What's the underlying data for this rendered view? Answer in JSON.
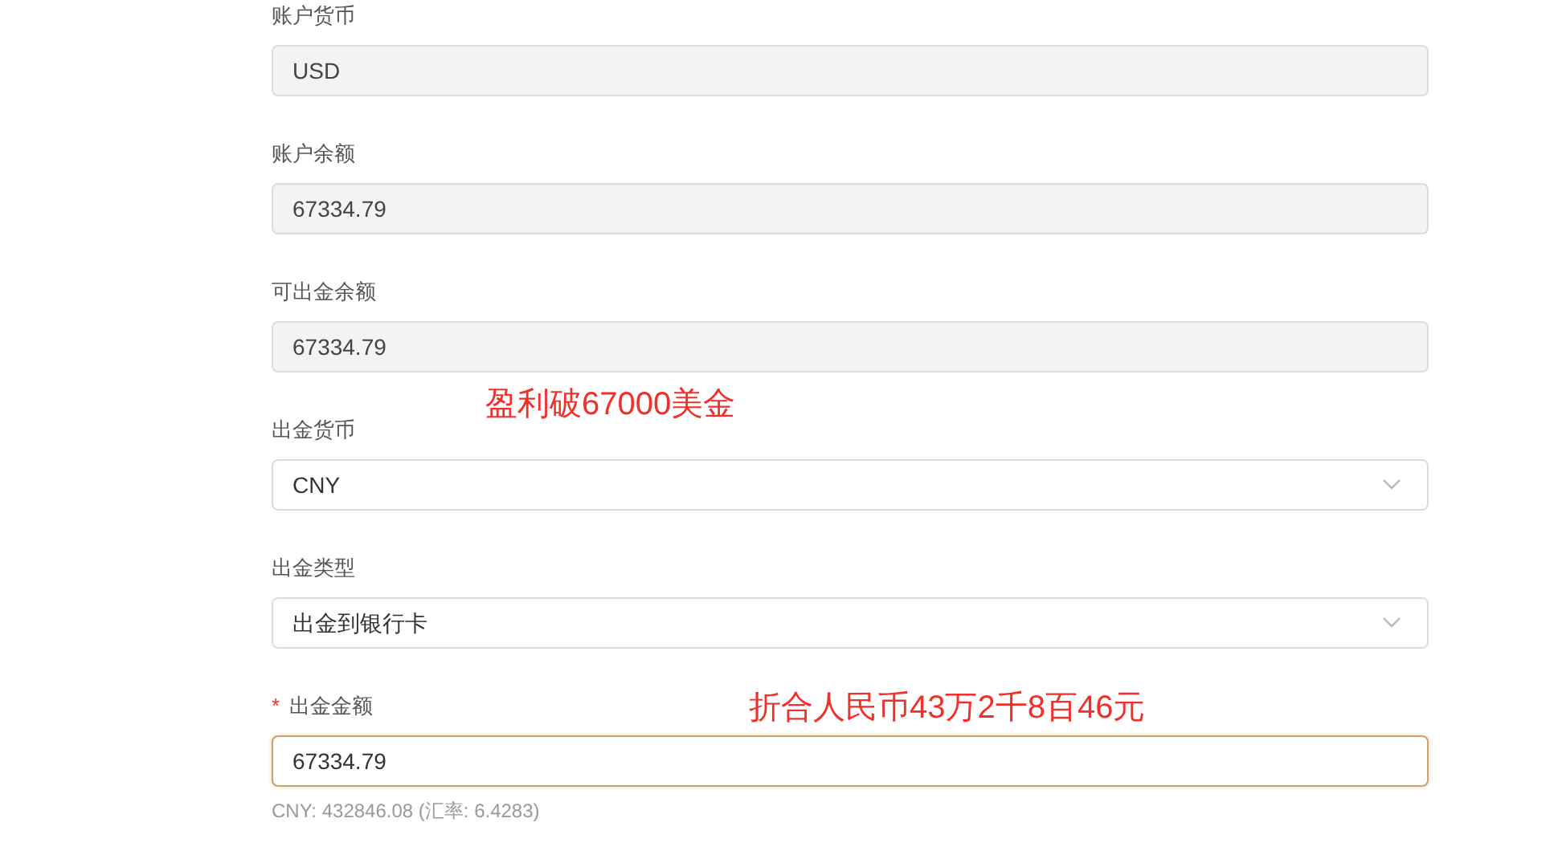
{
  "fields": [
    {
      "label": "账户货币",
      "kind": "readonly",
      "value": "USD",
      "required": false
    },
    {
      "label": "账户余额",
      "kind": "readonly",
      "value": "67334.79",
      "required": false
    },
    {
      "label": "可出金余额",
      "kind": "readonly",
      "value": "67334.79",
      "required": false
    },
    {
      "label": "出金货币",
      "kind": "select",
      "value": "CNY",
      "required": false
    },
    {
      "label": "出金类型",
      "kind": "select",
      "value": "出金到银行卡",
      "required": false
    },
    {
      "label": "出金金额",
      "kind": "input",
      "value": "67334.79",
      "required": true,
      "required_mark": "*",
      "hint": "CNY: 432846.08 (汇率: 6.4283)"
    }
  ],
  "annotations": [
    "盈利破67000美金",
    "折合人民币43万2千8百46元"
  ]
}
